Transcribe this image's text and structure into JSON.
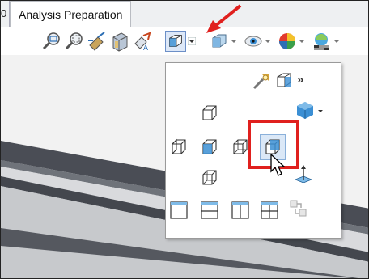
{
  "tabs": {
    "partial_label": "0",
    "active_label": "Analysis Preparation"
  },
  "flyout": {
    "overflow_label": "»"
  },
  "colors": {
    "highlight": "#e0201e",
    "annotation_arrow": "#e0201e",
    "cube_face": "#3b8fd4",
    "menu_border": "#9a9a9a"
  },
  "icons": {
    "toolbar": [
      "zoom-to-fit-icon",
      "zoom-to-area-icon",
      "previous-view-icon",
      "section-view-icon",
      "dynamic-annotation-icon",
      "view-orientation-icon",
      "display-style-icon",
      "hide-show-icon",
      "edit-appearance-icon",
      "apply-scene-icon"
    ],
    "flyout": [
      "view-selector-icon",
      "normal-to-icon",
      "front-view-icon",
      "top-view-icon",
      "isometric-icon",
      "left-view-icon",
      "right-view-icon",
      "back-view-icon",
      "dimetric-view-icon",
      "bottom-view-icon",
      "single-view-icon",
      "two-view-horizontal-icon",
      "two-view-vertical-icon",
      "four-view-icon",
      "link-views-icon"
    ]
  }
}
